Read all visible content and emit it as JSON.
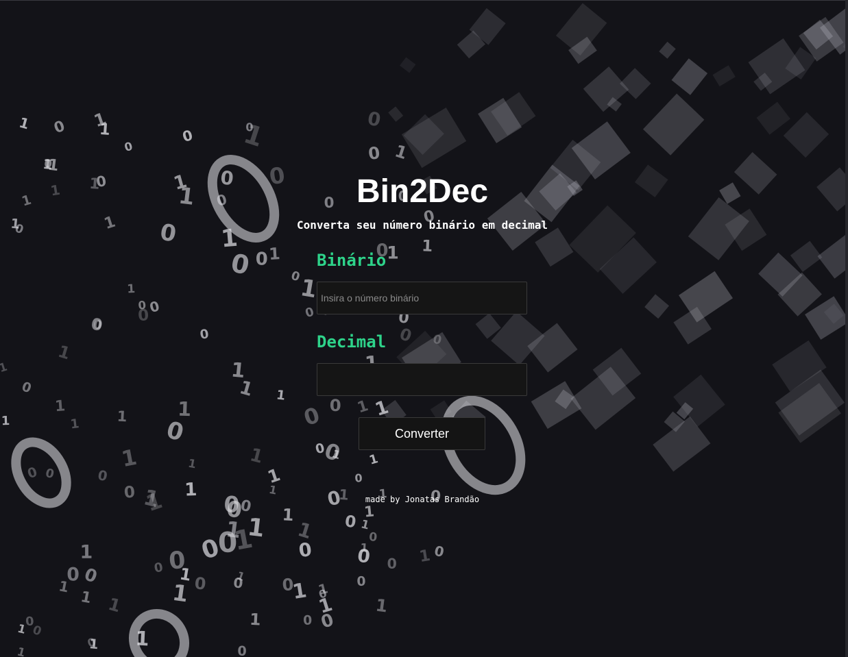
{
  "header": {
    "title": "Bin2Dec",
    "subtitle": "Converta seu número binário em decimal"
  },
  "form": {
    "binary_label": "Binário",
    "binary_placeholder": "Insira o número binário",
    "binary_value": "",
    "decimal_label": "Decimal",
    "decimal_value": "",
    "convert_label": "Converter"
  },
  "footer": {
    "credit": "made by Jonatas Brandão"
  },
  "colors": {
    "background": "#131318",
    "accent": "#2ed38a",
    "field_bg": "#151515",
    "text": "#ffffff"
  },
  "background_image": "binary-digits-3d-backdrop"
}
